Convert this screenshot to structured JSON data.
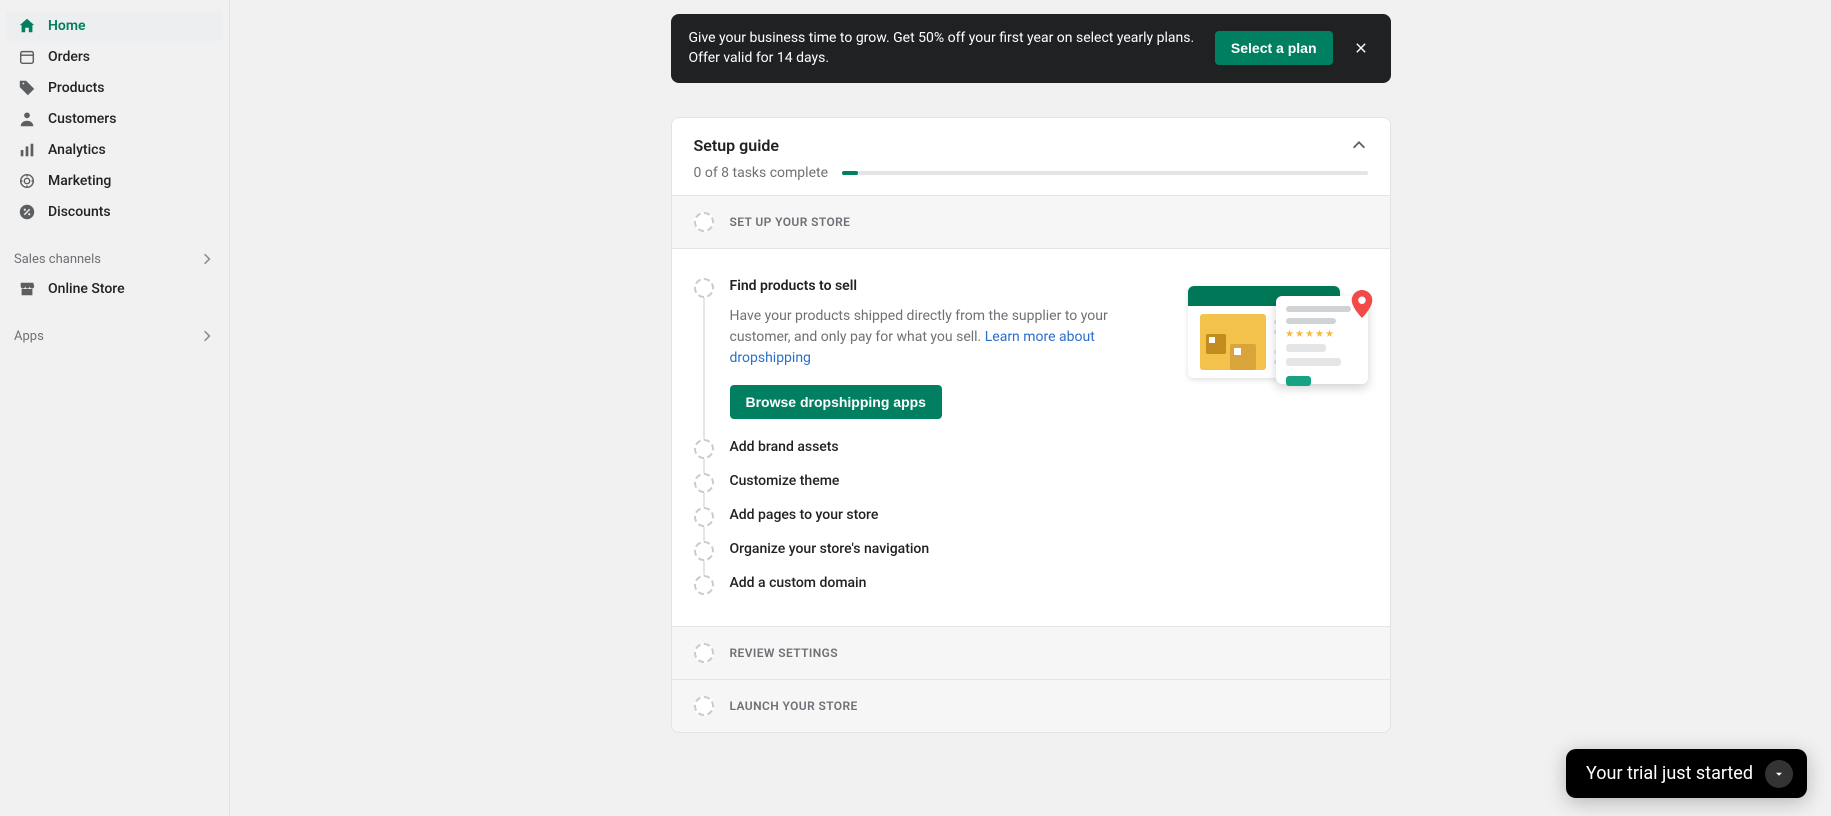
{
  "sidebar": {
    "items": [
      {
        "label": "Home",
        "active": true,
        "icon": "home"
      },
      {
        "label": "Orders",
        "icon": "orders"
      },
      {
        "label": "Products",
        "icon": "products"
      },
      {
        "label": "Customers",
        "icon": "customers"
      },
      {
        "label": "Analytics",
        "icon": "analytics"
      },
      {
        "label": "Marketing",
        "icon": "marketing"
      },
      {
        "label": "Discounts",
        "icon": "discounts"
      }
    ],
    "sections": {
      "sales_channels": {
        "label": "Sales channels",
        "items": [
          {
            "label": "Online Store",
            "icon": "store"
          }
        ]
      },
      "apps": {
        "label": "Apps"
      }
    }
  },
  "banner": {
    "message": "Give your business time to grow. Get 50% off your first year on select yearly plans. Offer valid for 14 days.",
    "cta": "Select a plan"
  },
  "setup": {
    "title": "Setup guide",
    "count": "0 of 8 tasks complete",
    "sections": {
      "setup_store": "SET UP YOUR STORE",
      "review_settings": "REVIEW SETTINGS",
      "launch": "LAUNCH YOUR STORE"
    },
    "tasks": [
      {
        "title": "Find products to sell",
        "desc": "Have your products shipped directly from the supplier to your customer, and only pay for what you sell. ",
        "link": "Learn more about dropshipping",
        "cta": "Browse dropshipping apps",
        "expanded": true
      },
      {
        "title": "Add brand assets"
      },
      {
        "title": "Customize theme"
      },
      {
        "title": "Add pages to your store"
      },
      {
        "title": "Organize your store's navigation"
      },
      {
        "title": "Add a custom domain"
      }
    ]
  },
  "trial": {
    "label": "Your trial just started"
  }
}
